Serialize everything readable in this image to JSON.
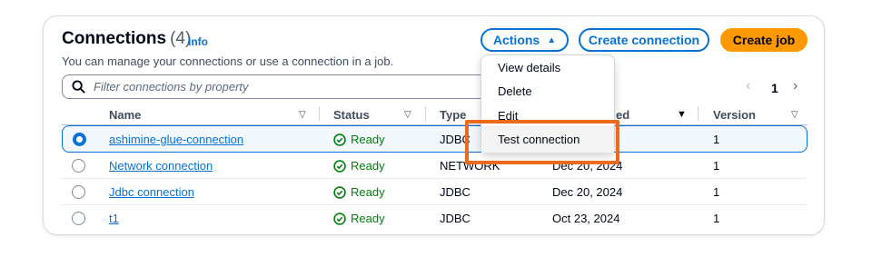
{
  "header": {
    "title": "Connections",
    "count": "(4)",
    "info": "Info",
    "description": "You can manage your connections or use a connection in a job."
  },
  "buttons": {
    "actions": "Actions",
    "create_connection": "Create connection",
    "create_job": "Create job"
  },
  "filter": {
    "placeholder": "Filter connections by property"
  },
  "pagination": {
    "page": "1"
  },
  "columns": {
    "name": "Name",
    "status": "Status",
    "type": "Type",
    "created": "ed",
    "version": "Version"
  },
  "rows": [
    {
      "name": "ashimine-glue-connection",
      "status": "Ready",
      "type": "JDBC",
      "created": "",
      "version": "1",
      "selected": true
    },
    {
      "name": "Network connection",
      "status": "Ready",
      "type": "NETWORK",
      "created": "Dec 20, 2024",
      "version": "1",
      "selected": false
    },
    {
      "name": "Jdbc connection",
      "status": "Ready",
      "type": "JDBC",
      "created": "Dec 20, 2024",
      "version": "1",
      "selected": false
    },
    {
      "name": "t1",
      "status": "Ready",
      "type": "JDBC",
      "created": "Oct 23, 2024",
      "version": "1",
      "selected": false
    }
  ],
  "actions_menu": {
    "items": [
      "View details",
      "Delete",
      "Edit",
      "Test connection"
    ],
    "highlighted": "Test connection"
  },
  "colors": {
    "accent": "#0972d3",
    "primary_button": "#ff9900",
    "status_ready": "#037f0c",
    "annotation": "#ec6b1b"
  },
  "icons": {
    "search": "search-icon",
    "status_ok": "check-circle-icon",
    "sort": "sort-triangle-icon",
    "pager_prev": "chevron-left-icon",
    "pager_next": "chevron-right-icon"
  }
}
